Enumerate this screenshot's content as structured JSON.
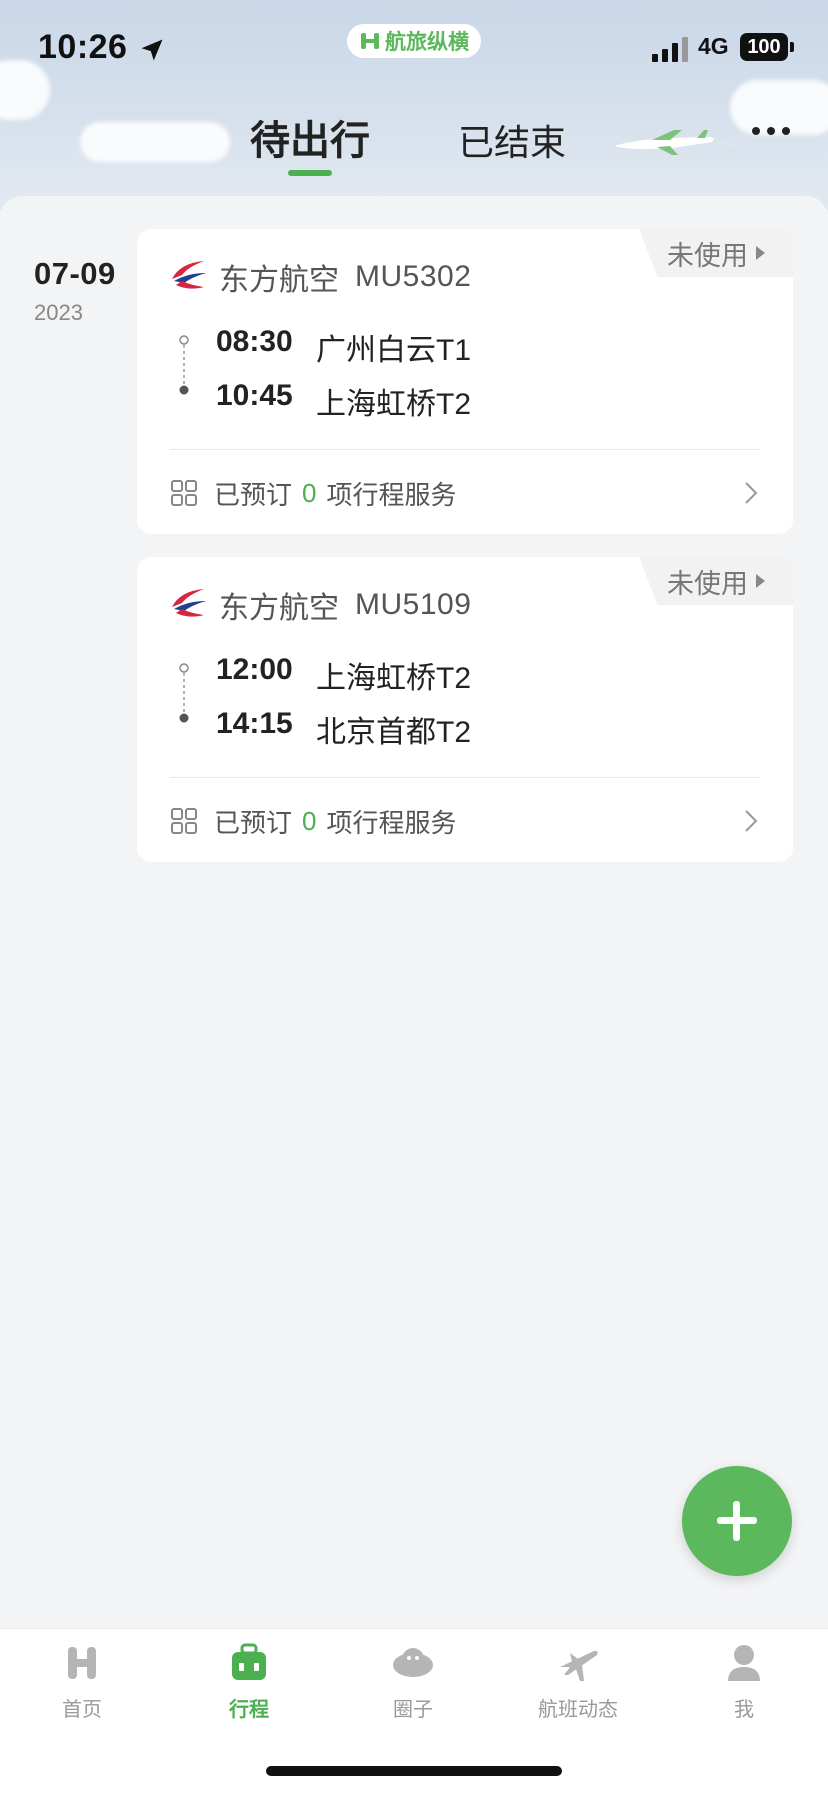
{
  "status_bar": {
    "time": "10:26",
    "network": "4G",
    "battery": "100",
    "app_pill": "航旅纵横"
  },
  "header": {
    "tabs": [
      {
        "label": "待出行",
        "active": true
      },
      {
        "label": "已结束",
        "active": false
      }
    ],
    "more_icon": "more-horizontal-icon"
  },
  "date": {
    "day": "07-09",
    "year": "2023"
  },
  "trips": [
    {
      "status": "未使用",
      "airline": "东方航空",
      "flight_no": "MU5302",
      "depart_time": "08:30",
      "depart_place": "广州白云T1",
      "arrive_time": "10:45",
      "arrive_place": "上海虹桥T2",
      "svc_prefix": "已预订",
      "svc_count": "0",
      "svc_suffix": "项行程服务"
    },
    {
      "status": "未使用",
      "airline": "东方航空",
      "flight_no": "MU5109",
      "depart_time": "12:00",
      "depart_place": "上海虹桥T2",
      "arrive_time": "14:15",
      "arrive_place": "北京首都T2",
      "svc_prefix": "已预订",
      "svc_count": "0",
      "svc_suffix": "项行程服务"
    }
  ],
  "fab": {
    "icon": "plus-icon"
  },
  "tabbar": [
    {
      "label": "首页",
      "icon": "home-icon",
      "active": false
    },
    {
      "label": "行程",
      "icon": "briefcase-icon",
      "active": true
    },
    {
      "label": "圈子",
      "icon": "community-icon",
      "active": false
    },
    {
      "label": "航班动态",
      "icon": "plane-icon",
      "active": false
    },
    {
      "label": "我",
      "icon": "user-icon",
      "active": false
    }
  ],
  "colors": {
    "accent": "#4caf50",
    "airline_red": "#d7263d",
    "airline_blue": "#1f3f8f"
  }
}
